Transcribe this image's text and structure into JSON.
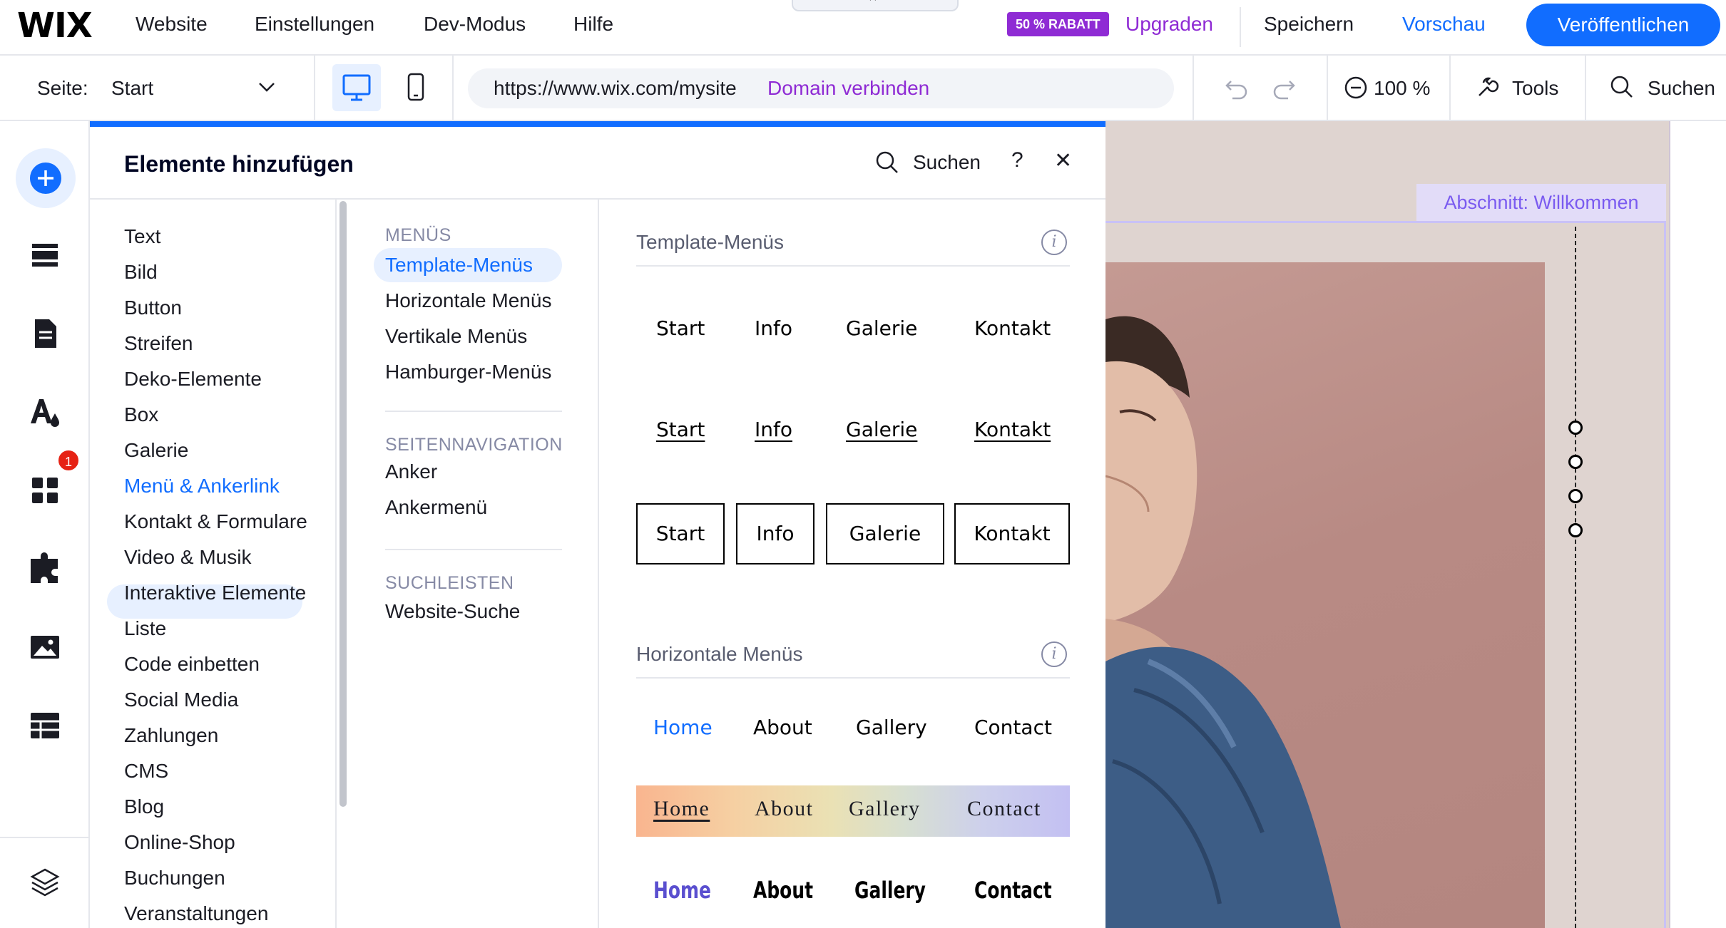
{
  "topbar": {
    "logo": "WIX",
    "nav": [
      "Website",
      "Einstellungen",
      "Dev-Modus",
      "Hilfe"
    ],
    "notch_icon": "×",
    "badge": "50 % RABATT",
    "upgrade": "Upgraden",
    "save": "Speichern",
    "preview": "Vorschau",
    "publish": "Veröffentlichen"
  },
  "toolbar": {
    "page_label": "Seite:",
    "page_value": "Start",
    "url": "https://www.wix.com/mysite",
    "domain_link": "Domain verbinden",
    "zoom": "100 %",
    "tools": "Tools",
    "search": "Suchen"
  },
  "rail": {
    "icons": [
      "add-icon",
      "sections-icon",
      "pages-icon",
      "design-icon",
      "apps-icon",
      "business-icon",
      "media-icon",
      "cms-icon",
      "layers-icon"
    ],
    "apps_badge": "1",
    "accent": "#116dff"
  },
  "panel": {
    "title": "Elemente hinzufügen",
    "search": "Suchen",
    "help": "?",
    "close": "✕",
    "categories": [
      "Text",
      "Bild",
      "Button",
      "Streifen",
      "Deko-Elemente",
      "Box",
      "Galerie",
      "Menü & Ankerlink",
      "Kontakt & Formulare",
      "Video & Musik",
      "Interaktive Elemente",
      "Liste",
      "Code einbetten",
      "Social Media",
      "Zahlungen",
      "CMS",
      "Blog",
      "Online-Shop",
      "Buchungen",
      "Veranstaltungen"
    ],
    "active_category": "Menü & Ankerlink",
    "sub_sections": [
      {
        "heading": "MENÜS",
        "items": [
          "Template-Menüs",
          "Horizontale Menüs",
          "Vertikale Menüs",
          "Hamburger-Menüs"
        ]
      },
      {
        "heading": "SEITENNAVIGATION",
        "items": [
          "Anker",
          "Ankermenü"
        ]
      },
      {
        "heading": "SUCHLEISTEN",
        "items": [
          "Website-Suche"
        ]
      }
    ],
    "active_sub": "Template-Menüs"
  },
  "content": {
    "section1_title": "Template-Menüs",
    "template_menu_plain": [
      "Start",
      "Info",
      "Galerie",
      "Kontakt"
    ],
    "template_menu_underlined": [
      "Start",
      "Info",
      "Galerie",
      "Kontakt"
    ],
    "template_menu_boxed": [
      "Start",
      "Info",
      "Galerie",
      "Kontakt"
    ],
    "section2_title": "Horizontale Menüs",
    "horizontal_menu_1": [
      "Home",
      "About",
      "Gallery",
      "Contact"
    ],
    "horizontal_menu_2": [
      "Home",
      "About",
      "Gallery",
      "Contact"
    ],
    "horizontal_menu_3": [
      "Home",
      "About",
      "Gallery",
      "Contact"
    ],
    "active_link_color": "#116dff",
    "accent_violet": "#5a4fcf"
  },
  "canvas": {
    "section_label": "Abschnitt: Willkommen",
    "label_color": "#7a5bf0"
  }
}
